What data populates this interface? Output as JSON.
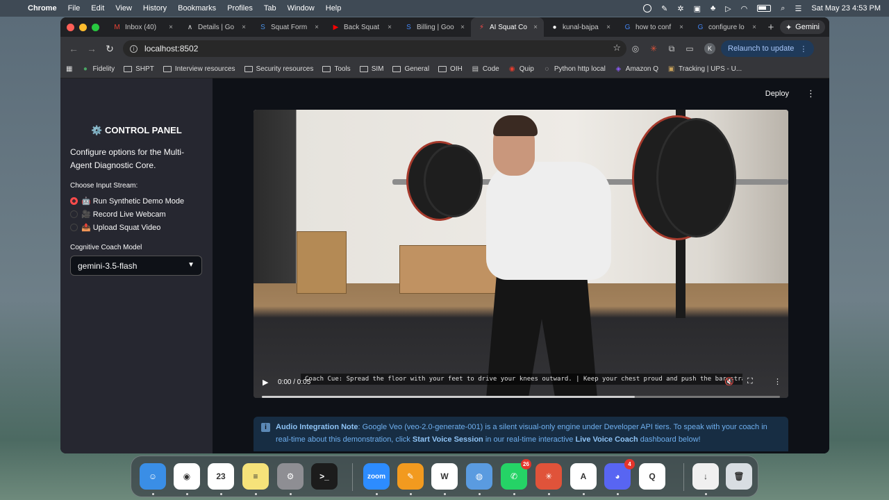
{
  "menubar": {
    "items": [
      "Chrome",
      "File",
      "Edit",
      "View",
      "History",
      "Bookmarks",
      "Profiles",
      "Tab",
      "Window",
      "Help"
    ],
    "datetime": "Sat May 23  4:53 PM"
  },
  "tabs": [
    {
      "label": "Inbox (40)",
      "icon": "gmail-icon",
      "color": "#ea4335",
      "glyph": "M"
    },
    {
      "label": "Details | Go",
      "icon": "chart-line-icon",
      "color": "#dddddd",
      "glyph": "∧"
    },
    {
      "label": "Squat Form",
      "icon": "squat-app-icon",
      "color": "#4a90e2",
      "glyph": "S"
    },
    {
      "label": "Back Squat",
      "icon": "youtube-icon",
      "color": "#ff0000",
      "glyph": "▶"
    },
    {
      "label": "Billing | Goo",
      "icon": "billing-icon",
      "color": "#4285f4",
      "glyph": "S"
    },
    {
      "label": "AI Squat Co",
      "icon": "streamlit-icon",
      "color": "#ff4b4b",
      "glyph": "⚡"
    },
    {
      "label": "kunal-bajpa",
      "icon": "github-icon",
      "color": "#ffffff",
      "glyph": "●"
    },
    {
      "label": "how to conf",
      "icon": "google-icon",
      "color": "#4285f4",
      "glyph": "G"
    },
    {
      "label": "configure lo",
      "icon": "google-icon",
      "color": "#4285f4",
      "glyph": "G"
    }
  ],
  "gemini_label": "Gemini",
  "address": "localhost:8502",
  "relaunch_label": "Relaunch to update",
  "bookmarks": [
    {
      "label": "Fidelity",
      "icon": "fidelity-icon"
    },
    {
      "label": "SHPT",
      "icon": "folder-icon"
    },
    {
      "label": "Interview resources",
      "icon": "folder-icon"
    },
    {
      "label": "Security resources",
      "icon": "folder-icon"
    },
    {
      "label": "Tools",
      "icon": "folder-icon"
    },
    {
      "label": "SIM",
      "icon": "folder-icon"
    },
    {
      "label": "General",
      "icon": "folder-icon"
    },
    {
      "label": "OIH",
      "icon": "folder-icon"
    },
    {
      "label": "Code",
      "icon": "code-icon"
    },
    {
      "label": "Quip",
      "icon": "quip-icon"
    },
    {
      "label": "Python http local",
      "icon": "globe-icon"
    },
    {
      "label": "Amazon Q",
      "icon": "amazon-q-icon"
    },
    {
      "label": "Tracking | UPS - U...",
      "icon": "ups-icon"
    }
  ],
  "sidebar": {
    "title": "⚙️ CONTROL PANEL",
    "description": "Configure options for the Multi-Agent Diagnostic Core.",
    "input_label": "Choose Input Stream:",
    "options": [
      {
        "emoji": "🤖",
        "label": "Run Synthetic Demo Mode",
        "selected": true
      },
      {
        "emoji": "🎥",
        "label": "Record Live Webcam",
        "selected": false
      },
      {
        "emoji": "📤",
        "label": "Upload Squat Video",
        "selected": false
      }
    ],
    "model_label": "Cognitive Coach Model",
    "model_value": "gemini-3.5-flash"
  },
  "header": {
    "deploy_label": "Deploy"
  },
  "video": {
    "caption": "Coach Cue: Spread the floor with your feet to drive your knees outward. | Keep your chest proud and push the bar straight up.",
    "time": "0:00 / 0:05",
    "progress": 0.72
  },
  "note": {
    "title": "Audio Integration Note",
    "text1": ": Google Veo (veo-2.0-generate-001) is a silent visual-only engine under Developer API tiers. To speak with your coach in real-time about this demonstration, click ",
    "bold1": "Start Voice Session",
    "text2": " in our real-time interactive ",
    "bold2": "Live Voice Coach",
    "text3": " dashboard below!"
  },
  "dock": [
    {
      "name": "finder-icon",
      "color": "#3a8ee6",
      "glyph": "☺",
      "badge": ""
    },
    {
      "name": "chrome-icon",
      "color": "#ffffff",
      "glyph": "◉",
      "badge": ""
    },
    {
      "name": "calendar-icon",
      "color": "#ffffff",
      "glyph": "23",
      "badge": ""
    },
    {
      "name": "notes-icon",
      "color": "#f6e27a",
      "glyph": "≡",
      "badge": ""
    },
    {
      "name": "system-settings-icon",
      "color": "#8e8e93",
      "glyph": "⚙",
      "badge": ""
    },
    {
      "name": "terminal-icon",
      "color": "#1c1c1c",
      "glyph": ">_",
      "badge": ""
    },
    {
      "name": "zoom-icon",
      "color": "#2d8cff",
      "glyph": "zoom",
      "badge": ""
    },
    {
      "name": "pages-icon",
      "color": "#f29a1f",
      "glyph": "✎",
      "badge": ""
    },
    {
      "name": "word-icon",
      "color": "#ffffff",
      "glyph": "W",
      "badge": ""
    },
    {
      "name": "marker-app-icon",
      "color": "#5a9be0",
      "glyph": "◍",
      "badge": ""
    },
    {
      "name": "whatsapp-icon",
      "color": "#25d366",
      "glyph": "✆",
      "badge": "26"
    },
    {
      "name": "claude-icon",
      "color": "#e0533a",
      "glyph": "✳",
      "badge": ""
    },
    {
      "name": "artifact-icon",
      "color": "#ffffff",
      "glyph": "A",
      "badge": ""
    },
    {
      "name": "discord-icon",
      "color": "#5865f2",
      "glyph": "◕",
      "badge": "4"
    },
    {
      "name": "quicktime-icon",
      "color": "#ffffff",
      "glyph": "Q",
      "badge": ""
    },
    {
      "name": "downloads-icon",
      "color": "#f0f0f0",
      "glyph": "↓",
      "badge": ""
    },
    {
      "name": "trash-icon",
      "color": "#d8dde2",
      "glyph": "🗑",
      "badge": ""
    }
  ]
}
